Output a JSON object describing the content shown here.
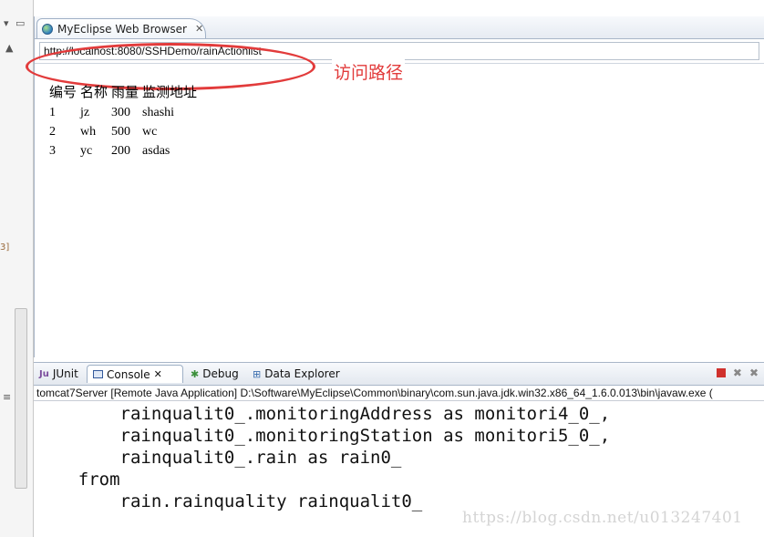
{
  "browser": {
    "tab_label": "MyEclipse Web Browser",
    "tab_close": "✕",
    "url": "http://localhost:8080/SSHDemo/rainActionlist",
    "annotation": "访问路径",
    "table": {
      "headers": [
        "编号",
        "名称",
        "雨量",
        "监测地址"
      ],
      "rows": [
        [
          "1",
          "jz",
          "300",
          "shashi"
        ],
        [
          "2",
          "wh",
          "500",
          "wc"
        ],
        [
          "3",
          "yc",
          "200",
          "asdas"
        ]
      ]
    }
  },
  "views": {
    "tabs": [
      "JUnit",
      "Console",
      "Debug",
      "Data Explorer"
    ],
    "console_close": "✕"
  },
  "console": {
    "status": "tomcat7Server [Remote Java Application] D:\\Software\\MyEclipse\\Common\\binary\\com.sun.java.jdk.win32.x86_64_1.6.0.013\\bin\\javaw.exe (",
    "lines": [
      "        rainqualit0_.monitoringAddress as monitori4_0_,",
      "        rainqualit0_.monitoringStation as monitori5_0_,",
      "        rainqualit0_.rain as rain0_",
      "    from",
      "        rain.rainquality rainqualit0_"
    ]
  },
  "gutter": {
    "edge_label": "3]"
  },
  "watermark": "https://blog.csdn.net/u013247401",
  "colors": {
    "annotation": "#e23b3b",
    "tab_border": "#9fb0c6"
  },
  "icons": [
    "globe-icon",
    "close-icon",
    "junit-icon",
    "console-icon",
    "debug-icon",
    "data-explorer-icon",
    "stop-icon",
    "remove-launch-icon",
    "remove-all-icon"
  ]
}
